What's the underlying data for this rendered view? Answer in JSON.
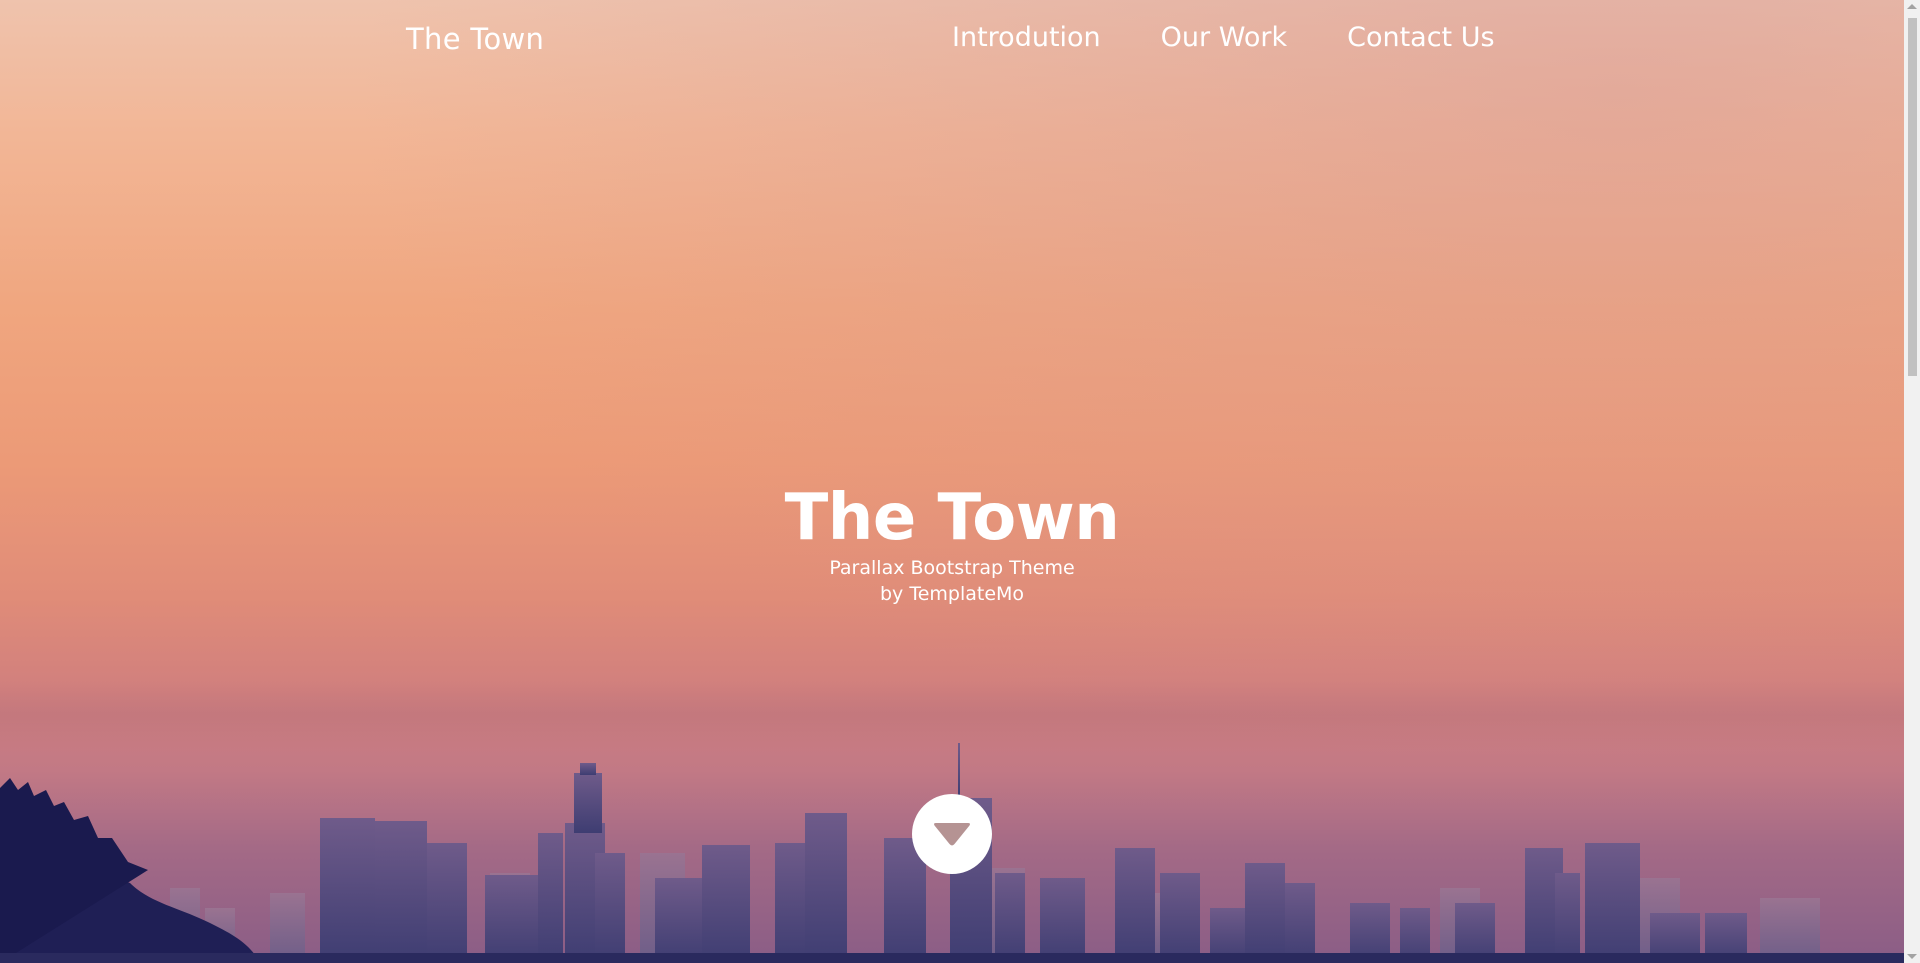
{
  "navbar": {
    "brand": "The Town",
    "links": [
      {
        "label": "Introdution"
      },
      {
        "label": "Our Work"
      },
      {
        "label": "Contact Us"
      }
    ]
  },
  "hero": {
    "title": "The Town",
    "subtitle_line1": "Parallax Bootstrap Theme",
    "subtitle_line2": "by TemplateMo"
  },
  "scroll_button": {
    "icon": "triangle-down-icon"
  },
  "colors": {
    "text": "#ffffff",
    "skyline": "#3f3d70",
    "arrow": "#b59393"
  }
}
